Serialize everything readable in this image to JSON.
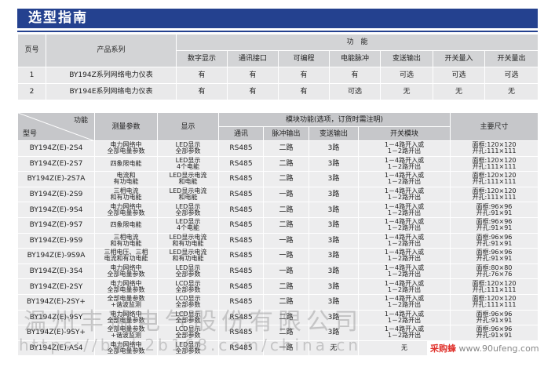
{
  "header": {
    "title": "选型指南"
  },
  "table1": {
    "h_index": "页号",
    "h_series": "产品系列",
    "h_function": "功　能",
    "sub_headers": [
      "数字显示",
      "通讯接口",
      "可编程",
      "电能脉冲",
      "变送输出",
      "开关量入",
      "开关量出"
    ],
    "rows": [
      {
        "idx": "1",
        "series": "BY194Z系列网络电力仪表",
        "vals": [
          "有",
          "有",
          "有",
          "有",
          "可选",
          "可选",
          "可选"
        ]
      },
      {
        "idx": "2",
        "series": "BY194E系列网络电力仪表",
        "vals": [
          "有",
          "有",
          "有",
          "可选",
          "无",
          "无",
          "无"
        ]
      }
    ]
  },
  "table2": {
    "h_function": "功能",
    "h_model": "型号",
    "h_params": "测量参数",
    "h_display": "显示",
    "h_module": "模块功能(选项，订货时需注明)",
    "h_size": "主要尺寸",
    "sub_headers": [
      "通讯",
      "脉冲输出",
      "变送输出",
      "开关模块"
    ],
    "rows": [
      {
        "model": "BY194Z(E)-2S4",
        "p1": "电力网络中",
        "p2": "全部电量参数",
        "d1": "LED显示",
        "d2": "全部参数",
        "comm": "RS485",
        "pulse": "二路",
        "trans": "3路",
        "s1": "1－4路开入或",
        "s2": "1－2路开出",
        "z1": "面框:120×120",
        "z2": "开孔:111×111"
      },
      {
        "model": "BY194Z(E)-2S7",
        "p1": "四象限电能",
        "p2": "",
        "d1": "LED显示",
        "d2": "4个电能",
        "comm": "RS485",
        "pulse": "二路",
        "trans": "3路",
        "s1": "1－4路开入或",
        "s2": "1－2路开出",
        "z1": "面框:120×120",
        "z2": "开孔:111×111"
      },
      {
        "model": "BY194Z(E)-2S7A",
        "p1": "电流和",
        "p2": "有功电能",
        "d1": "LED显示电流",
        "d2": "和电能",
        "comm": "RS485",
        "pulse": "二路",
        "trans": "3路",
        "s1": "1－4路开入或",
        "s2": "1－2路开出",
        "z1": "面框:120×120",
        "z2": "开孔:111×111"
      },
      {
        "model": "BY194Z(E)-2S9",
        "p1": "三相电流",
        "p2": "和有功电能",
        "d1": "LED显示电流",
        "d2": "和电能",
        "comm": "RS485",
        "pulse": "一路",
        "trans": "3路",
        "s1": "1－4路开入或",
        "s2": "1－2路开出",
        "z1": "面框:120×120",
        "z2": "开孔:111×111"
      },
      {
        "model": "BY194Z(E)-9S4",
        "p1": "电力网络中",
        "p2": "全部电量参数",
        "d1": "LED显示",
        "d2": "全部参数",
        "comm": "RS485",
        "pulse": "二路",
        "trans": "3路",
        "s1": "1－4路开入或",
        "s2": "1－2路开出",
        "z1": "面框:96×96",
        "z2": "开孔:91×91"
      },
      {
        "model": "BY194Z(E)-9S7",
        "p1": "四象限电能",
        "p2": "",
        "d1": "LED显示",
        "d2": "4个电能",
        "comm": "RS485",
        "pulse": "二路",
        "trans": "3路",
        "s1": "1－4路开入或",
        "s2": "1－2路开出",
        "z1": "面框:96×96",
        "z2": "开孔:91×91"
      },
      {
        "model": "BY194Z(E)-9S9",
        "p1": "三相电流",
        "p2": "和有功电能",
        "d1": "LED显示电流",
        "d2": "和有功电能",
        "comm": "RS485",
        "pulse": "一路",
        "trans": "3路",
        "s1": "1－4路开入或",
        "s2": "1－2路开出",
        "z1": "面框:96×96",
        "z2": "开孔:91×91"
      },
      {
        "model": "BY194Z(E)-9S9A",
        "p1": "三相电压、三相",
        "p2": "电流和有功电能",
        "d1": "LED显示电流",
        "d2": "和有功电能",
        "comm": "RS485",
        "pulse": "一路",
        "trans": "3路",
        "s1": "1－4路开入或",
        "s2": "1－2路开出",
        "z1": "面框:96×96",
        "z2": "开孔:91×91"
      },
      {
        "model": "BY194Z(E)-3S4",
        "p1": "电力网络中",
        "p2": "全部电量参数",
        "d1": "LED显示",
        "d2": "全部参数",
        "comm": "RS485",
        "pulse": "一路",
        "trans": "3路",
        "s1": "1－4路开入或",
        "s2": "1－2路开出",
        "z1": "面框:80×80",
        "z2": "开孔:76×76"
      },
      {
        "model": "BY194Z(E)-2SY",
        "p1": "电力网络中",
        "p2": "全部电量参数",
        "d1": "LCD显示",
        "d2": "全部参数",
        "comm": "RS485",
        "pulse": "二路",
        "trans": "3路",
        "s1": "1－4路开入或",
        "s2": "1－2路开出",
        "z1": "面框:120×120",
        "z2": "开孔:111×111"
      },
      {
        "model": "BY194Z(E)-2SY+",
        "p1": "全部电量参数",
        "p2": "+谐波监测",
        "d1": "LCD显示",
        "d2": "全部参数",
        "comm": "RS485",
        "pulse": "二路",
        "trans": "3路",
        "s1": "1－4路开入或",
        "s2": "1－2路开出",
        "z1": "面框:120×120",
        "z2": "开孔:111×111"
      },
      {
        "model": "BY194Z(E)-9SY",
        "p1": "电力网络中",
        "p2": "全部电量参数",
        "d1": "LCD显示",
        "d2": "全部参数",
        "comm": "RS485",
        "pulse": "二路",
        "trans": "3路",
        "s1": "1－4路开入或",
        "s2": "1－2路开出",
        "z1": "面框:96×96",
        "z2": "开孔:91×91"
      },
      {
        "model": "BY194Z(E)-9SY+",
        "p1": "全部电量参数",
        "p2": "+谐波监测",
        "d1": "LCD显示",
        "d2": "全部参数",
        "comm": "RS485",
        "pulse": "二路",
        "trans": "3路",
        "s1": "1－4路开入或",
        "s2": "1－2路开出",
        "z1": "面框:96×96",
        "z2": "开孔:91×91"
      },
      {
        "model": "BY194Z(E)-AS4",
        "p1": "电力网络中",
        "p2": "全部电量参数",
        "d1": "LED显示",
        "d2": "全部参数",
        "comm": "RS485",
        "pulse": "一路",
        "trans": "无",
        "s1": "无",
        "s2": "",
        "z1": "面框:72×72",
        "z2": "开孔:66×66"
      }
    ]
  },
  "watermark": {
    "line1": "温州丰瑞电气股份有限公司",
    "line2": "https://by.b2b168.com/china.cn"
  },
  "stamp": {
    "brand": "采购蜂",
    "site": "www.90ufeng.com"
  },
  "colors": {
    "banner": "#24418f",
    "header_cell": "#c6c7ca",
    "body_cell": "#ededee"
  }
}
